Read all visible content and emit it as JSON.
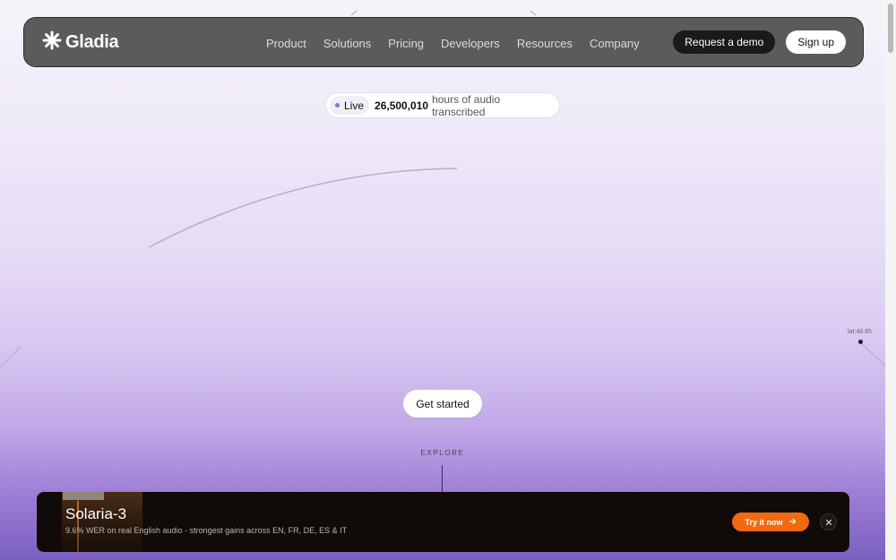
{
  "brand": {
    "name": "Gladia",
    "logo_icon": "asterisk-logo-icon"
  },
  "nav": {
    "links": [
      "Product",
      "Solutions",
      "Pricing",
      "Developers",
      "Resources",
      "Company"
    ],
    "request_demo": "Request a demo",
    "sign_up": "Sign up"
  },
  "live": {
    "tag": "Live",
    "count": "26,500,010",
    "text": "hours of audio transcribed"
  },
  "hero": {
    "cta": "Get started",
    "explore": "EXPLORE",
    "lat_label": "lat:48.85"
  },
  "banner": {
    "title": "Solaria-3",
    "subtitle": "9.6% WER on real English audio - strongest gains across EN, FR, DE, ES & IT",
    "cta": "Try it now",
    "close_icon": "close-icon"
  },
  "colors": {
    "accent_orange": "#f06a12",
    "nav_bg": "#5b5b5b",
    "banner_bg": "#100b08",
    "live_dot": "#8a6de0"
  }
}
